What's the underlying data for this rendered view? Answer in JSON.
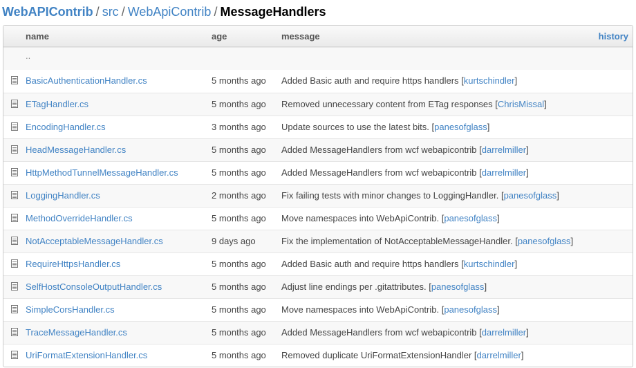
{
  "breadcrumb": {
    "root": "WebAPIContrib",
    "sep": "/",
    "src": "src",
    "project": "WebApiContrib",
    "current": "MessageHandlers"
  },
  "header": {
    "name": "name",
    "age": "age",
    "message": "message",
    "history": "history"
  },
  "parent_dir": "..",
  "files": [
    {
      "name": "BasicAuthenticationHandler.cs",
      "age": "5 months ago",
      "message": "Added Basic auth and require https handlers",
      "author": "kurtschindler"
    },
    {
      "name": "ETagHandler.cs",
      "age": "5 months ago",
      "message": "Removed unnecessary content from ETag responses",
      "author": "ChrisMissal"
    },
    {
      "name": "EncodingHandler.cs",
      "age": "3 months ago",
      "message": "Update sources to use the latest bits.",
      "author": "panesofglass"
    },
    {
      "name": "HeadMessageHandler.cs",
      "age": "5 months ago",
      "message": "Added MessageHandlers from wcf webapicontrib",
      "author": "darrelmiller"
    },
    {
      "name": "HttpMethodTunnelMessageHandler.cs",
      "age": "5 months ago",
      "message": "Added MessageHandlers from wcf webapicontrib",
      "author": "darrelmiller"
    },
    {
      "name": "LoggingHandler.cs",
      "age": "2 months ago",
      "message": "Fix failing tests with minor changes to LoggingHandler.",
      "author": "panesofglass"
    },
    {
      "name": "MethodOverrideHandler.cs",
      "age": "5 months ago",
      "message": "Move namespaces into WebApiContrib.",
      "author": "panesofglass"
    },
    {
      "name": "NotAcceptableMessageHandler.cs",
      "age": "9 days ago",
      "message": "Fix the implementation of NotAcceptableMessageHandler.",
      "author": "panesofglass"
    },
    {
      "name": "RequireHttpsHandler.cs",
      "age": "5 months ago",
      "message": "Added Basic auth and require https handlers",
      "author": "kurtschindler"
    },
    {
      "name": "SelfHostConsoleOutputHandler.cs",
      "age": "5 months ago",
      "message": "Adjust line endings per .gitattributes.",
      "author": "panesofglass"
    },
    {
      "name": "SimpleCorsHandler.cs",
      "age": "5 months ago",
      "message": "Move namespaces into WebApiContrib.",
      "author": "panesofglass"
    },
    {
      "name": "TraceMessageHandler.cs",
      "age": "5 months ago",
      "message": "Added MessageHandlers from wcf webapicontrib",
      "author": "darrelmiller"
    },
    {
      "name": "UriFormatExtensionHandler.cs",
      "age": "5 months ago",
      "message": "Removed duplicate UriFormatExtensionHandler",
      "author": "darrelmiller"
    }
  ]
}
